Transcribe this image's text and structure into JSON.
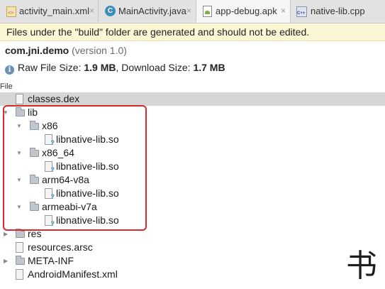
{
  "tabs": [
    {
      "label": "activity_main.xml",
      "icon": "xml-file-icon",
      "active": false
    },
    {
      "label": "MainActivity.java",
      "icon": "java-class-icon",
      "active": false
    },
    {
      "label": "app-debug.apk",
      "icon": "apk-file-icon",
      "active": true
    },
    {
      "label": "native-lib.cpp",
      "icon": "cpp-file-icon",
      "active": false
    }
  ],
  "tab_close_glyph": "×",
  "banner": {
    "text": "Files under the \"build\" folder are generated and should not be edited."
  },
  "package": {
    "name": "com.jni.demo",
    "version": "(version 1.0)"
  },
  "sizes": {
    "raw_label": "Raw File Size:",
    "raw_value": "1.9 MB",
    "separator": ",",
    "download_label": "Download Size:",
    "download_value": "1.7 MB"
  },
  "tree": {
    "column_header": "File",
    "rows": [
      {
        "label": "classes.dex",
        "kind": "file",
        "depth": 0,
        "selected": true
      },
      {
        "label": "lib",
        "kind": "folder",
        "depth": 0,
        "expanded": true
      },
      {
        "label": "x86",
        "kind": "folder",
        "depth": 1,
        "expanded": true
      },
      {
        "label": "libnative-lib.so",
        "kind": "file",
        "depth": 2
      },
      {
        "label": "x86_64",
        "kind": "folder",
        "depth": 1,
        "expanded": true
      },
      {
        "label": "libnative-lib.so",
        "kind": "file",
        "depth": 2
      },
      {
        "label": "arm64-v8a",
        "kind": "folder",
        "depth": 1,
        "expanded": true
      },
      {
        "label": "libnative-lib.so",
        "kind": "file",
        "depth": 2
      },
      {
        "label": "armeabi-v7a",
        "kind": "folder",
        "depth": 1,
        "expanded": true
      },
      {
        "label": "libnative-lib.so",
        "kind": "file",
        "depth": 2
      },
      {
        "label": "res",
        "kind": "folder",
        "depth": 0,
        "expanded": false
      },
      {
        "label": "resources.arsc",
        "kind": "file",
        "depth": 0
      },
      {
        "label": "META-INF",
        "kind": "folder",
        "depth": 0,
        "expanded": false
      },
      {
        "label": "AndroidManifest.xml",
        "kind": "file",
        "depth": 0
      }
    ]
  },
  "annotation": {
    "highlight_color": "#d52b2b"
  },
  "watermark": {
    "glyph": "书"
  },
  "colors": {
    "banner_bg": "#fbf6d3",
    "selection_bg": "#d6d6d6",
    "accent": "#3c8dbc"
  }
}
